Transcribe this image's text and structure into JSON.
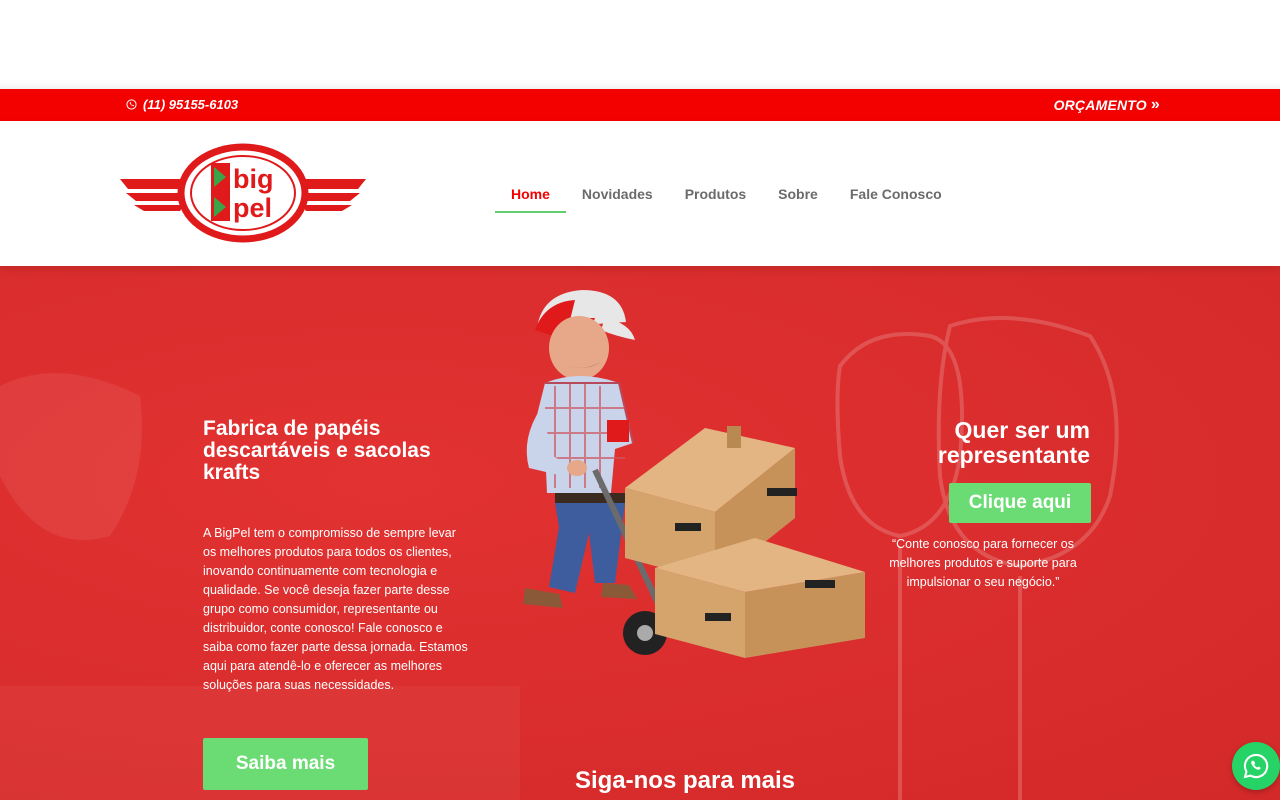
{
  "topbar": {
    "phone": "(11) 95155-6103",
    "phone_icon": "whatsapp-icon",
    "cta": "ORÇAMENTO",
    "cta_icon": "double-chevron-right-icon"
  },
  "brand": {
    "logo_line1": "big",
    "logo_line2": "pel",
    "red": "#f30000",
    "green": "#61ce70"
  },
  "nav": {
    "items": [
      {
        "label": "Home",
        "active": true
      },
      {
        "label": "Novidades",
        "active": false
      },
      {
        "label": "Produtos",
        "active": false
      },
      {
        "label": "Sobre",
        "active": false
      },
      {
        "label": "Fale Conosco",
        "active": false
      }
    ]
  },
  "hero": {
    "left_title": "Fabrica de papéis descartáveis e sacolas krafts",
    "left_text": "A BigPel tem o compromisso de sempre levar os melhores produtos para todos os clientes, inovando continuamente com tecnologia e qualidade. Se você deseja fazer parte desse grupo como consumidor, representante ou distribuidor, conte conosco! Fale conosco e saiba como fazer parte dessa jornada. Estamos aqui para atendê-lo e oferecer as melhores soluções para suas necessidades.",
    "left_button": "Saiba mais",
    "right_title": "Quer ser um representante",
    "right_button": "Clique aqui",
    "right_quote": "“Conte conosco para fornecer os melhores produtos e suporte para impulsionar o seu negócio.”",
    "follow_title": "Siga-nos para mais"
  },
  "floating": {
    "whatsapp_icon": "whatsapp-icon",
    "whatsapp_color": "#25d366"
  }
}
